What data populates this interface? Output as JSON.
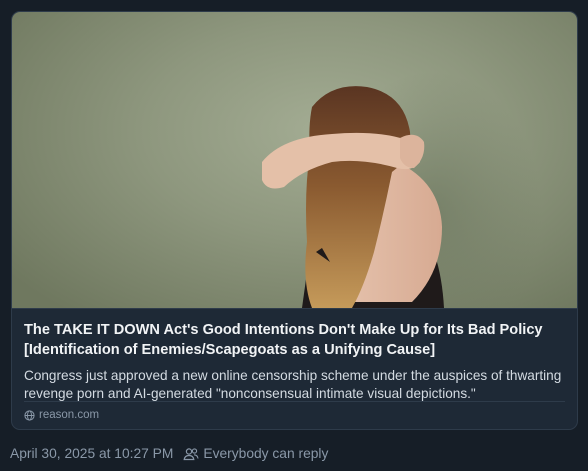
{
  "embed": {
    "image_alt": "Woman with long hair facing a wall, arms raised around her head",
    "title": "The TAKE IT DOWN Act's Good Intentions Don't Make Up for Its Bad Policy [Identification of Enemies/Scapegoats as a Unifying Cause]",
    "description": "Congress just approved a new online censorship scheme under the auspices of thwarting revenge porn and AI-generated \"nonconsensual intimate visual depictions.\"",
    "domain": "reason.com",
    "domain_icon": "globe-icon"
  },
  "post_meta": {
    "timestamp": "April 30, 2025 at 10:27 PM",
    "reply_icon": "people-icon",
    "reply_setting": "Everybody can reply"
  },
  "colors": {
    "background": "#161e27",
    "card": "#1e2936",
    "border": "#2e3b4a",
    "muted_text": "#8a98a8"
  }
}
